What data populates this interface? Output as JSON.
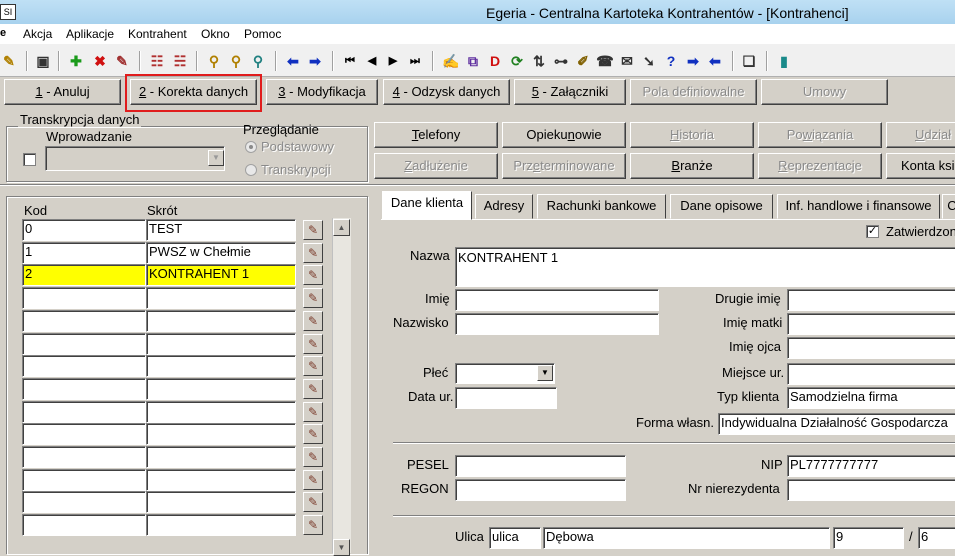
{
  "window": {
    "title": "Egeria - Centralna Kartoteka Kontrahentów - [Kontrahenci]",
    "app_icon": "app-icon"
  },
  "menu": [
    "Akcja",
    "Aplikacje",
    "Kontrahent",
    "Okno",
    "Pomoc"
  ],
  "action_buttons": [
    {
      "key": "1",
      "label": " - Anuluj",
      "enabled": true
    },
    {
      "key": "2",
      "label": " - Korekta danych",
      "enabled": true,
      "highlighted": true
    },
    {
      "key": "3",
      "label": " - Modyfikacja",
      "enabled": true
    },
    {
      "key": "4",
      "label": " - Odzysk danych",
      "enabled": true
    },
    {
      "key": "5",
      "label": " - Załączniki",
      "enabled": true
    },
    {
      "key": "",
      "label": "Pola definiowalne",
      "enabled": false
    },
    {
      "key": "",
      "label": "Umowy",
      "enabled": false
    }
  ],
  "transcription": {
    "group_title": "Transkrypcja danych",
    "entry_label": "Wprowadzanie",
    "browse_label": "Przeglądanie",
    "option_basic": "Podstawowy",
    "option_transcriptions": "Transkrypcji"
  },
  "feature_buttons": {
    "row1": [
      {
        "label": "Telefony",
        "enabled": true
      },
      {
        "label": "Opiekunowie",
        "enabled": true
      },
      {
        "label": "Historia",
        "enabled": false
      },
      {
        "label": "Powiązania",
        "enabled": false
      },
      {
        "label": "Udział",
        "enabled": false
      }
    ],
    "row2": [
      {
        "label": "Zadłużenie",
        "enabled": false
      },
      {
        "label": "Przeterminowane",
        "enabled": false
      },
      {
        "label": "Branże",
        "enabled": true
      },
      {
        "label": "Reprezentacje",
        "enabled": false
      },
      {
        "label": "Konta ksi",
        "enabled": true
      }
    ]
  },
  "list": {
    "col_code": "Kod",
    "col_short": "Skrót",
    "rows": [
      {
        "code": "0",
        "short": "TEST"
      },
      {
        "code": "1",
        "short": "PWSZ w Chełmie"
      },
      {
        "code": "2",
        "short": "KONTRAHENT 1",
        "selected": true
      },
      {
        "code": "",
        "short": ""
      },
      {
        "code": "",
        "short": ""
      },
      {
        "code": "",
        "short": ""
      },
      {
        "code": "",
        "short": ""
      },
      {
        "code": "",
        "short": ""
      },
      {
        "code": "",
        "short": ""
      },
      {
        "code": "",
        "short": ""
      },
      {
        "code": "",
        "short": ""
      },
      {
        "code": "",
        "short": ""
      },
      {
        "code": "",
        "short": ""
      },
      {
        "code": "",
        "short": ""
      }
    ]
  },
  "tabs": [
    "Dane klienta",
    "Adresy",
    "Rachunki bankowe",
    "Dane opisowe",
    "Inf. handlowe i finansowe",
    "C"
  ],
  "form": {
    "approved_label": "Zatwierdzon",
    "approved_checked": "✓",
    "name_label": "Nazwa",
    "name_value": "KONTRAHENT 1",
    "first_name_label": "Imię",
    "first_name_value": "",
    "second_name_label": "Drugie imię",
    "second_name_value": "",
    "surname_label": "Nazwisko",
    "surname_value": "",
    "mother_name_label": "Imię matki",
    "mother_name_value": "",
    "father_name_label": "Imię ojca",
    "father_name_value": "",
    "sex_label": "Płeć",
    "sex_value": "",
    "birthplace_label": "Miejsce ur.",
    "birthplace_value": "",
    "birthdate_label": "Data ur.",
    "birthdate_value": "",
    "client_type_label": "Typ klienta",
    "client_type_value": "Samodzielna firma",
    "ownership_label": "Forma własn.",
    "ownership_value": "Indywidualna Działalność Gospodarcza",
    "pesel_label": "PESEL",
    "pesel_value": "",
    "nip_label": "NIP",
    "nip_value": "PL7777777777",
    "regon_label": "REGON",
    "regon_value": "",
    "nonresident_label": "Nr nierezydenta",
    "nonresident_value": "",
    "street_label": "Ulica",
    "street_type": "ulica",
    "street_name": "Dębowa",
    "house_no": "9",
    "slash": "/",
    "flat_no": "6"
  }
}
